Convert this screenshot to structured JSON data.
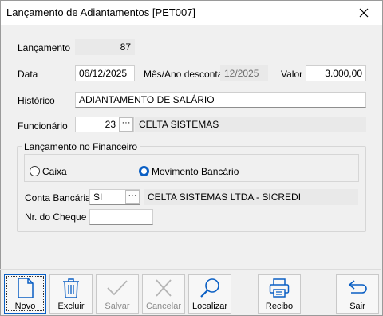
{
  "window": {
    "title": "Lançamento de Adiantamentos [PET007]"
  },
  "form": {
    "lancamento": {
      "label": "Lançamento",
      "value": "87"
    },
    "data": {
      "label": "Data",
      "value": "06/12/2025"
    },
    "mes_ano": {
      "label": "Mês/Ano descontar",
      "value": "12/2025"
    },
    "valor": {
      "label": "Valor",
      "value": "3.000,00"
    },
    "historico": {
      "label": "Histórico",
      "value": "ADIANTAMENTO DE SALÁRIO"
    },
    "funcionario": {
      "label": "Funcionário",
      "code": "23",
      "name": "CELTA SISTEMAS",
      "lookup": "···"
    }
  },
  "financeiro": {
    "title": "Lançamento no Financeiro",
    "radio_caixa": "Caixa",
    "radio_movimento": "Movimento Bancário",
    "selected": "Movimento Bancário",
    "conta_bancaria": {
      "label": "Conta Bancária",
      "code": "SI",
      "name": "CELTA SISTEMAS LTDA - SICREDI",
      "lookup": "···"
    },
    "nr_cheque": {
      "label": "Nr. do Cheque",
      "value": ""
    }
  },
  "toolbar": {
    "novo": {
      "first": "N",
      "rest": "ovo"
    },
    "excluir": {
      "first": "E",
      "rest": "xcluir"
    },
    "salvar": {
      "first": "S",
      "rest": "alvar"
    },
    "cancelar": {
      "first": "C",
      "rest": "ancelar"
    },
    "localizar": {
      "first": "L",
      "rest": "ocalizar"
    },
    "recibo": {
      "first": "R",
      "rest": "ecibo"
    },
    "sair": {
      "first": "S",
      "rest": "air"
    }
  },
  "icons": [
    "close-icon",
    "new-document-icon",
    "trash-icon",
    "check-icon",
    "cancel-x-icon",
    "search-icon",
    "printer-icon",
    "exit-arrow-icon"
  ],
  "colors": {
    "accent": "#0a5fc4",
    "disabled": "#b5b5b5",
    "readonly_bg": "#e9e9e9"
  }
}
